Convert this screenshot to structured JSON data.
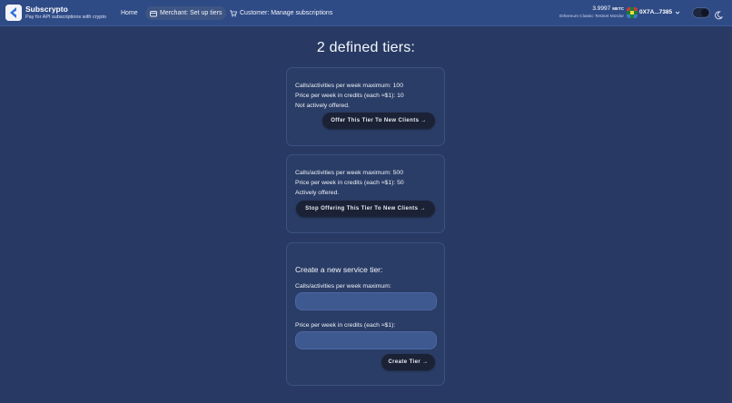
{
  "header": {
    "brand_title": "Subscrypto",
    "brand_subtitle": "Pay for API subscriptions with crypto",
    "nav": {
      "home": "Home",
      "merchant": "Merchant: Set up tiers",
      "customer": "Customer: Manage subscriptions"
    },
    "balance_value": "3.9997",
    "balance_unit": "METC",
    "network": "Ethereum Classic Testnet Mordor",
    "address": "0X7A...7385"
  },
  "main": {
    "title": "2 defined tiers:",
    "tiers": [
      {
        "calls": "Calls/activities per week maximum: 100",
        "price": "Price per week in credits (each ≈$1): 10",
        "status": "Not actively offered.",
        "button": "Offer This Tier To New Clients →"
      },
      {
        "calls": "Calls/activities per week maximum: 500",
        "price": "Price per week in credits (each ≈$1): 50",
        "status": "Actively offered.",
        "button": "Stop Offering This Tier To New Clients →"
      }
    ],
    "create_form": {
      "heading": "Create a new service tier:",
      "calls_label": "Calls/activities per week maximum:",
      "calls_value": "",
      "price_label": "Price per week in credits (each ≈$1):",
      "price_value": "",
      "submit": "Create Tier →"
    }
  },
  "colors": {
    "background": "#283a63",
    "header": "#2f4b86",
    "button": "#1b2235",
    "input": "#3e5890"
  }
}
